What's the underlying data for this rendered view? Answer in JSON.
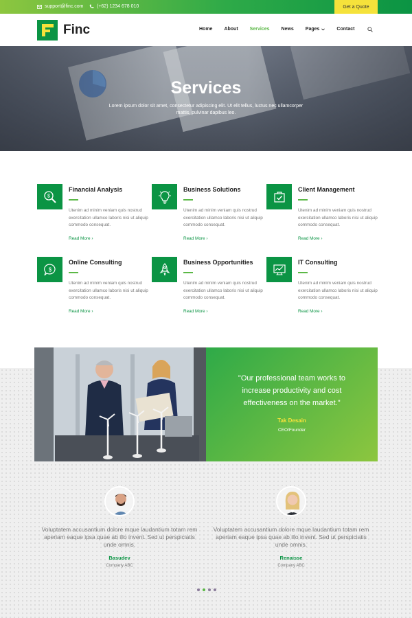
{
  "topbar": {
    "email": "support@finc.com",
    "phone": "(+62) 1234 678 010",
    "cta": "Get a Quote"
  },
  "brand": {
    "name": "Finc",
    "accent": "#0b9444",
    "highlight": "#f5e23b",
    "light_green": "#5bb846"
  },
  "nav": {
    "items": [
      "Home",
      "About",
      "Services",
      "News",
      "Pages",
      "Contact"
    ],
    "active": "Services"
  },
  "hero": {
    "title": "Services",
    "subtitle": "Lorem ipsum dolor sit amet, consectetur adipiscing elit. Ut elit tellus, luctus nec ullamcorper mattis, pulvinar dapibus leo."
  },
  "services": [
    {
      "title": "Financial Analysis",
      "icon": "magnifier-dollar-icon",
      "desc": "Utenim ad minim veniam quis nostrud exercitation ullamco laboris nisi ut aliquip commodo consequat.",
      "link": "Read More"
    },
    {
      "title": "Business Solutions",
      "icon": "lightbulb-icon",
      "desc": "Utenim ad minim veniam quis nostrud exercitation ullamco laboris nisi ut aliquip commodo consequat.",
      "link": "Read More"
    },
    {
      "title": "Client Management",
      "icon": "briefcase-check-icon",
      "desc": "Utenim ad minim veniam quis nostrud exercitation ullamco laboris nisi ut aliquip commodo consequat.",
      "link": "Read More"
    },
    {
      "title": "Online Consulting",
      "icon": "chat-dollar-icon",
      "desc": "Utenim ad minim veniam quis nostrud exercitation ullamco laboris nisi ut aliquip commodo consequat.",
      "link": "Read More"
    },
    {
      "title": "Business Opportunities",
      "icon": "rocket-icon",
      "desc": "Utenim ad minim veniam quis nostrud exercitation ullamco laboris nisi ut aliquip commodo consequat.",
      "link": "Read More"
    },
    {
      "title": "IT Consulting",
      "icon": "monitor-chart-icon",
      "desc": "Utenim ad minim veniam quis nostrud exercitation ullamco laboris nisi ut aliquip commodo consequat.",
      "link": "Read More"
    }
  ],
  "quote": {
    "text": "\"Our professional team works to increase productivity and cost effectiveness on the market.\"",
    "name": "Tak Desain",
    "role": "CEO/Founder"
  },
  "testimonials": [
    {
      "text": "Voluptatem accusantium dolore mque laudantium totam rem aperiam eaque ipsa quae ab illo invent. Sed ut perspiciatis unde omnis.",
      "name": "Basudev",
      "company": "Company ABC"
    },
    {
      "text": "Voluptatem accusantium dolore mque laudantium totam rem aperiam eaque ipsa quae ab illo invent. Sed ut perspiciatis unde omnis.",
      "name": "Renaisse",
      "company": "Company ABC"
    }
  ],
  "carousel": {
    "count": 4,
    "active": 2
  }
}
